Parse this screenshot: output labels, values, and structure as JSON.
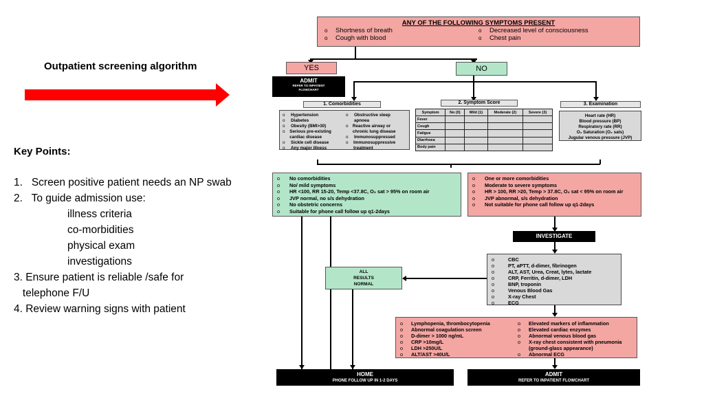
{
  "left_panel": {
    "title": "Outpatient screening algorithm",
    "arrow_color": "#ff0000",
    "key_points_title": "Key Points:",
    "key_points": [
      "1.   Screen positive patient needs an NP swab",
      "2.   To guide admission use:"
    ],
    "admission_criteria": [
      "illness criteria",
      "co-morbidities",
      "physical exam",
      "investigations"
    ],
    "key_points_2": [
      "3. Ensure patient is reliable /safe for",
      "   telephone F/U",
      "4. Review warning signs with patient"
    ]
  },
  "flowchart": {
    "colors": {
      "pink": "#f4a6a3",
      "green": "#b3e6c9",
      "grey": "#d9d9d9",
      "black": "#000000"
    },
    "bullet": "o",
    "top_box": {
      "title": "ANY OF THE FOLLOWING SYMPTOMS PRESENT",
      "items": [
        "Shortness of breath",
        "Decreased level of consciousness",
        "Cough with blood",
        "Chest pain"
      ]
    },
    "yes": "YES",
    "no": "NO",
    "admit_top": {
      "title": "ADMIT",
      "subtitle_1": "REFER TO INPATIENT",
      "subtitle_2": "FLOWCHART"
    },
    "comorbidities": {
      "title": "1. Comorbidities",
      "col1": [
        "Hypertension",
        "Diabetes",
        "Obesity (BMI>30)",
        "Serious pre-existing cardiac disease",
        "Sickle cell disease",
        "Any major illness"
      ],
      "col2": [
        "Obstructive sleep apnoea",
        "Reactive airway or chronic lung disease",
        "Immunosuppressed",
        "Immunosuppressive treatment"
      ]
    },
    "symptom_score": {
      "title": "2. Symptom Score",
      "headers": [
        "Symptom",
        "No (0)",
        "Mild (1)",
        "Moderate (2)",
        "Severe (3)"
      ],
      "rows": [
        "Fever",
        "Cough",
        "Fatigue",
        "Diarrhoea",
        "Body pain"
      ]
    },
    "examination": {
      "title": "3. Examination",
      "items": [
        "Heart rate (HR)",
        "Blood pressure (BP)",
        "Respiratory rate (RR)",
        "O₂ Saturation (O₂ sats)",
        "Jugular venous pressure (JVP)"
      ]
    },
    "low_risk": [
      "No comorbidities",
      "No/ mild symptoms",
      "HR <100, RR 15-20, Temp <37.8C, O₂ sat > 95% on room air",
      "JVP normal, no s/s dehydration",
      "No obstetric concerns",
      "Suitable for phone call follow up q1-2days"
    ],
    "high_risk": [
      "One or more comorbidities",
      "Moderate to severe symptoms",
      "HR > 100, RR >20, Temp > 37.8C, O₂ sat < 95% on room air",
      "JVP abnormal, s/s dehydration",
      "Not suitable for phone call follow up q1-2days"
    ],
    "investigate": "INVESTIGATE",
    "investigations": [
      "CBC",
      "PT, aPTT, d-dimer, fibrinogen",
      "ALT, AST, Urea, Creat, lytes, lactate",
      "CRP, Ferritin, d-dimer, LDH",
      "BNP, troponin",
      "Venous Blood Gas",
      "X-ray Chest",
      "ECG"
    ],
    "all_normal": [
      "ALL",
      "RESULTS",
      "NORMAL"
    ],
    "abnormal_col1": [
      "Lymphopenia, thrombocytopenia",
      "Abnormal coagulation screen",
      "D-dimer > 1000 ng/mL",
      "CRP >10mg/L",
      "LDH >250U/L",
      "ALT/AST >40U/L"
    ],
    "abnormal_col2": [
      "Elevated markers of inflammation",
      "Elevated cardiac enzymes",
      "Abnormal venous blood gas",
      "X-ray chest consistent with pneumonia (ground-glass appearance)",
      "Abnormal ECG"
    ],
    "home": {
      "title": "HOME",
      "subtitle": "PHONE FOLLOW UP IN 1-2 DAYS"
    },
    "admit_bottom": {
      "title": "ADMIT",
      "subtitle": "REFER TO INPATIENT FLOWCHART"
    }
  }
}
